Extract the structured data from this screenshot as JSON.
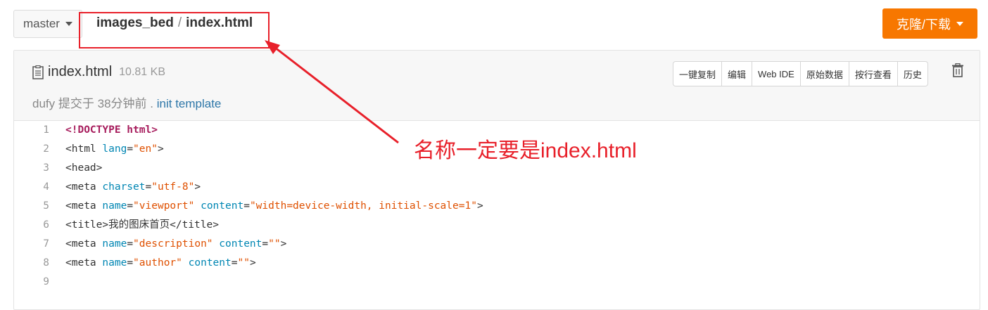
{
  "branch": {
    "label": "master"
  },
  "breadcrumb": {
    "repo": "images_bed",
    "separator": "/",
    "file": "index.html"
  },
  "clone_button": {
    "label": "克隆/下载"
  },
  "file": {
    "name": "index.html",
    "size": "10.81 KB",
    "commit": {
      "author": "dufy",
      "action": "提交于",
      "time": "38分钟前",
      "dot": ".",
      "message": "init template"
    },
    "actions": [
      "一键复制",
      "编辑",
      "Web IDE",
      "原始数据",
      "按行查看",
      "历史"
    ]
  },
  "code": {
    "lines": [
      {
        "num": "1",
        "text": "<!DOCTYPE html>"
      },
      {
        "num": "2",
        "text": "<html lang=\"en\">"
      },
      {
        "num": "3",
        "text": "<head>"
      },
      {
        "num": "4",
        "text": "<meta charset=\"utf-8\">"
      },
      {
        "num": "5",
        "text": "<meta name=\"viewport\" content=\"width=device-width, initial-scale=1\">"
      },
      {
        "num": "6",
        "text": "<title>我的图床首页</title>"
      },
      {
        "num": "7",
        "text": "<meta name=\"description\" content=\"\">"
      },
      {
        "num": "8",
        "text": "<meta name=\"author\" content=\"\">"
      },
      {
        "num": "9",
        "text": ""
      }
    ]
  },
  "annotation": {
    "text": "名称一定要是index.html",
    "color": "#e8202a"
  },
  "colors": {
    "accent": "#f77700",
    "link": "#2d76a8"
  }
}
